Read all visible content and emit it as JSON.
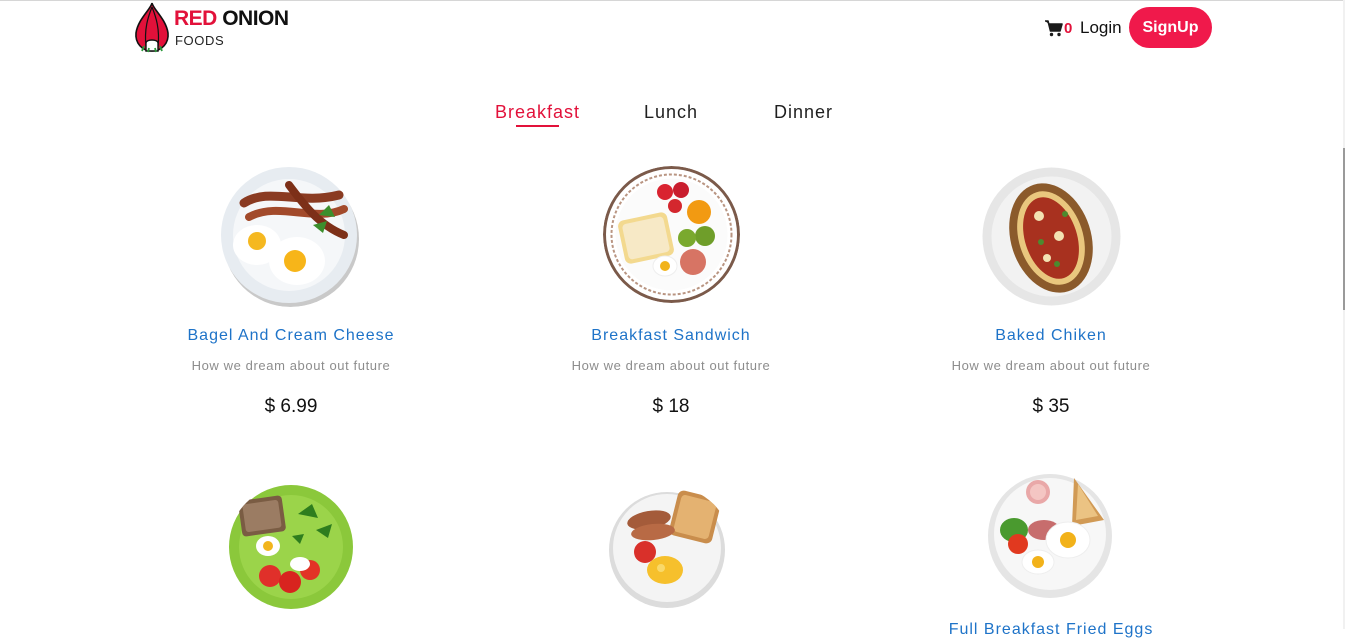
{
  "brand": {
    "name_part1": "RED",
    "name_part2": "ONION",
    "sub": "FOODS"
  },
  "header": {
    "cart_icon": "cart-icon",
    "cart_count": "0",
    "login_label": "Login",
    "signup_label": "SignUp"
  },
  "colors": {
    "accent": "#e2113a",
    "signup_bg": "#f0194b",
    "title_blue": "#1e73c8",
    "desc_gray": "#8d8d8d"
  },
  "tabs": [
    {
      "label": "Breakfast",
      "active": true
    },
    {
      "label": "Lunch",
      "active": false
    },
    {
      "label": "Dinner",
      "active": false
    }
  ],
  "foods": [
    {
      "title": "Bagel And Cream Cheese",
      "desc": "How we dream about out future",
      "price": "$ 6.99",
      "image": "bacon-eggs-plate"
    },
    {
      "title": "Breakfast Sandwich",
      "desc": "How we dream about out future",
      "price": "$ 18",
      "image": "bread-fruit-plate"
    },
    {
      "title": "Baked Chiken",
      "desc": "How we dream about out future",
      "price": "$ 35",
      "image": "baked-potato-plate"
    },
    {
      "title": "",
      "desc": "",
      "price": "",
      "image": "green-salad-plate"
    },
    {
      "title": "",
      "desc": "",
      "price": "",
      "image": "toast-sausage-plate"
    },
    {
      "title": "Full Breakfast Fried Eggs",
      "desc": "",
      "price": "",
      "image": "fried-eggs-toast-plate"
    }
  ]
}
